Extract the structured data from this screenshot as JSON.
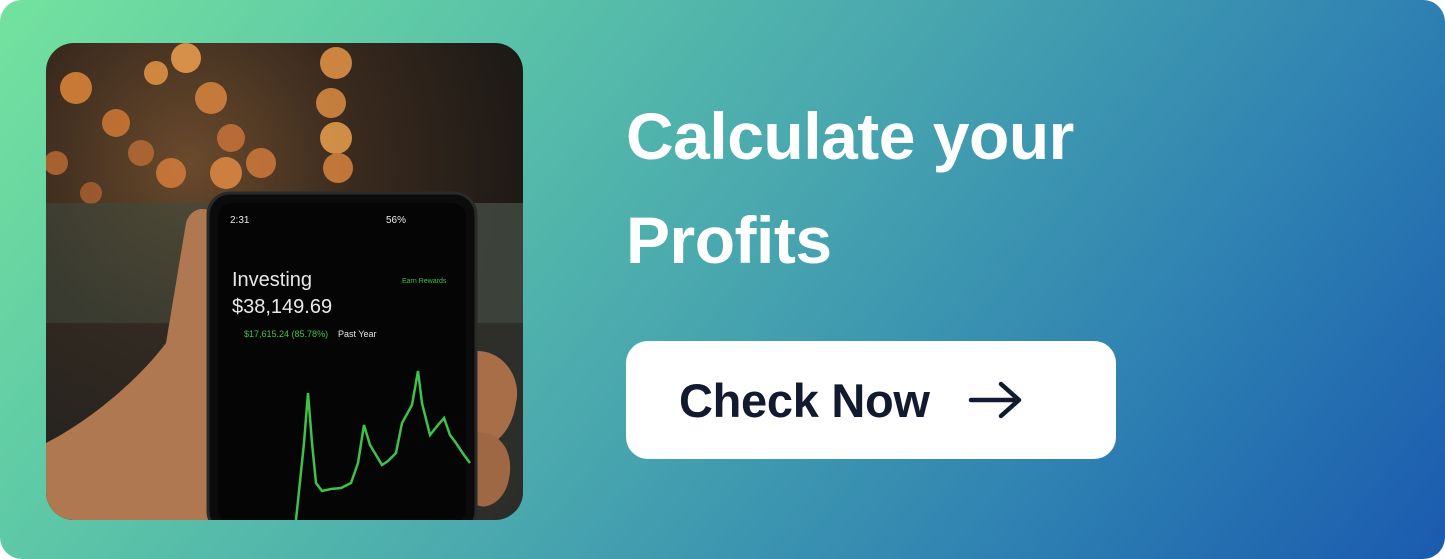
{
  "headline": {
    "line1": "Calculate your",
    "line2": "Profits"
  },
  "cta": {
    "label": "Check Now",
    "icon": "arrow-right-icon"
  },
  "photo": {
    "phone": {
      "time": "2:31",
      "battery": "56%",
      "app_title": "Investing",
      "balance": "$38,149.69",
      "change": "$17,615.24 (85.78%)",
      "period": "Past Year",
      "rewards": "Earn Rewards"
    }
  },
  "colors": {
    "gradient_start": "#74e29e",
    "gradient_end": "#1a5aaf",
    "cta_bg": "#ffffff",
    "cta_text": "#111a2e",
    "chart_line": "#3fc24a"
  }
}
